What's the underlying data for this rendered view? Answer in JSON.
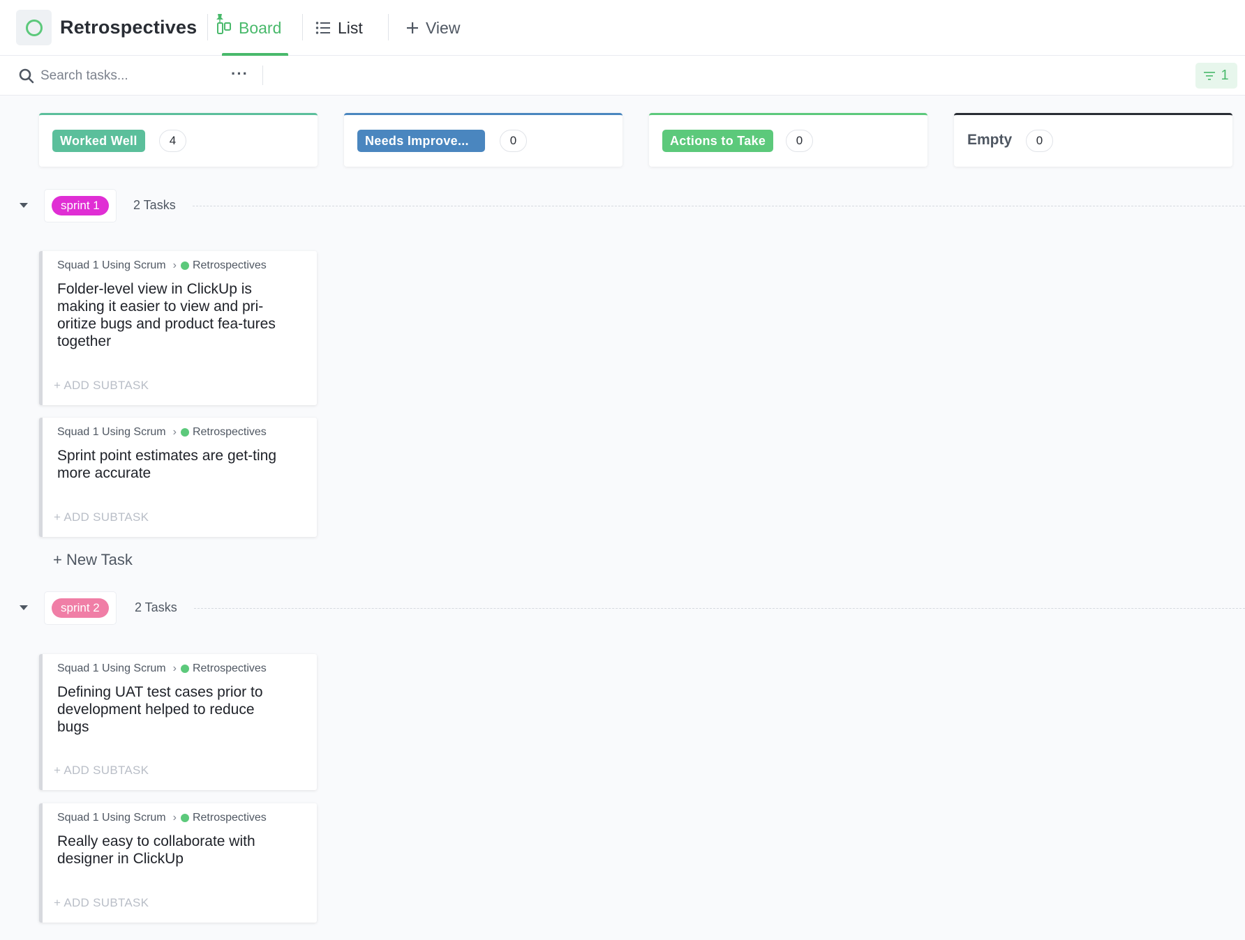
{
  "header": {
    "title": "Retrospectives",
    "tabs": [
      {
        "label": "Board",
        "icon": "board-icon"
      },
      {
        "label": "List",
        "icon": "list-icon"
      },
      {
        "label": "View",
        "icon": "plus-icon"
      }
    ]
  },
  "toolbar": {
    "search_placeholder": "Search tasks...",
    "more_label": "···",
    "filter_count": "1"
  },
  "columns": [
    {
      "label": "Worked Well",
      "count": "4",
      "color": "#5bbf9b"
    },
    {
      "label": "Needs Improve...",
      "count": "0",
      "color": "#4a86bf"
    },
    {
      "label": "Actions to Take",
      "count": "0",
      "color": "#5cc97b"
    },
    {
      "label": "Empty",
      "count": "0",
      "color": "#292d34"
    }
  ],
  "groups": [
    {
      "tag": "sprint 1",
      "tag_color": "#e02ed4",
      "count_label": "2 Tasks",
      "tasks": [
        {
          "breadcrumb_space": "Squad 1 Using Scrum",
          "breadcrumb_list": "Retrospectives",
          "title": "Folder-level view in ClickUp is making it easier to view and pri-oritize bugs and product fea-tures together",
          "add_subtask": "+ ADD SUBTASK"
        },
        {
          "breadcrumb_space": "Squad 1 Using Scrum",
          "breadcrumb_list": "Retrospectives",
          "title": "Sprint point estimates are get-ting more accurate",
          "add_subtask": "+ ADD SUBTASK"
        }
      ],
      "new_task_label": "+ New Task"
    },
    {
      "tag": "sprint 2",
      "tag_color": "#f07ea6",
      "count_label": "2 Tasks",
      "tasks": [
        {
          "breadcrumb_space": "Squad 1 Using Scrum",
          "breadcrumb_list": "Retrospectives",
          "title": "Defining UAT test cases prior to development helped to reduce bugs",
          "add_subtask": "+ ADD SUBTASK"
        },
        {
          "breadcrumb_space": "Squad 1 Using Scrum",
          "breadcrumb_list": "Retrospectives",
          "title": "Really easy to collaborate with designer in ClickUp",
          "add_subtask": "+ ADD SUBTASK"
        }
      ]
    }
  ],
  "colors": {
    "accent": "#49b96b",
    "status_dot": "#5cc97b"
  }
}
